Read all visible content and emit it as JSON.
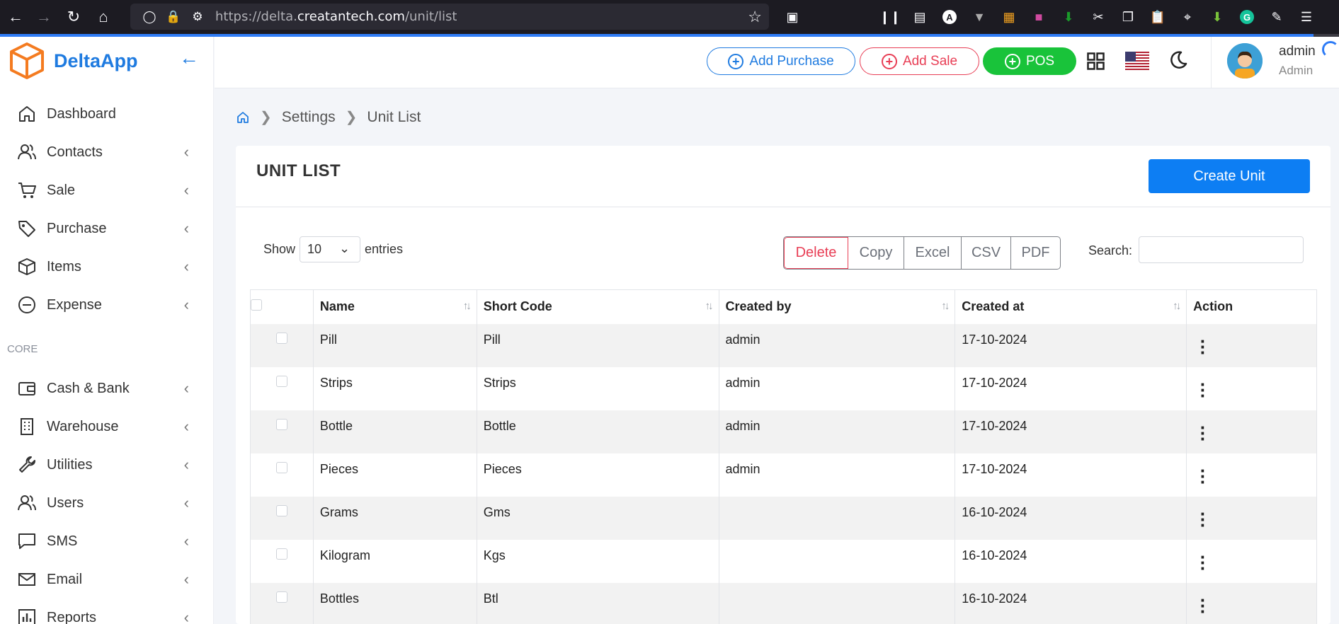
{
  "browser": {
    "url_prefix": "https://delta.",
    "url_domain": "creatantech.com",
    "url_path": "/unit/list"
  },
  "app": {
    "name": "DeltaApp"
  },
  "sidebar": {
    "items": [
      {
        "label": "Dashboard",
        "icon": "home-icon",
        "has_submenu": false
      },
      {
        "label": "Contacts",
        "icon": "contacts-icon",
        "has_submenu": true
      },
      {
        "label": "Sale",
        "icon": "cart-icon",
        "has_submenu": true
      },
      {
        "label": "Purchase",
        "icon": "tag-icon",
        "has_submenu": true
      },
      {
        "label": "Items",
        "icon": "box-icon",
        "has_submenu": true
      },
      {
        "label": "Expense",
        "icon": "minus-circle-icon",
        "has_submenu": true
      }
    ],
    "section_core": "CORE",
    "core_items": [
      {
        "label": "Cash & Bank",
        "icon": "wallet-icon",
        "has_submenu": true
      },
      {
        "label": "Warehouse",
        "icon": "building-icon",
        "has_submenu": true
      },
      {
        "label": "Utilities",
        "icon": "wrench-icon",
        "has_submenu": true
      },
      {
        "label": "Users",
        "icon": "users-icon",
        "has_submenu": true
      },
      {
        "label": "SMS",
        "icon": "message-icon",
        "has_submenu": true
      },
      {
        "label": "Email",
        "icon": "mail-icon",
        "has_submenu": true
      },
      {
        "label": "Reports",
        "icon": "chart-icon",
        "has_submenu": true
      }
    ]
  },
  "header": {
    "add_purchase": "Add Purchase",
    "add_sale": "Add Sale",
    "pos": "POS",
    "user_name": "admin",
    "user_role": "Admin"
  },
  "breadcrumb": {
    "items": [
      "Settings",
      "Unit List"
    ]
  },
  "page": {
    "title": "UNIT LIST",
    "create_button": "Create Unit",
    "show_label": "Show",
    "entries_label": "entries",
    "entries_value": "10",
    "search_label": "Search:",
    "export_buttons": [
      "Delete",
      "Copy",
      "Excel",
      "CSV",
      "PDF"
    ]
  },
  "table": {
    "columns": [
      "Name",
      "Short Code",
      "Created by",
      "Created at",
      "Action"
    ],
    "rows": [
      {
        "name": "Pill",
        "short_code": "Pill",
        "created_by": "admin",
        "created_at": "17-10-2024"
      },
      {
        "name": "Strips",
        "short_code": "Strips",
        "created_by": "admin",
        "created_at": "17-10-2024"
      },
      {
        "name": "Bottle",
        "short_code": "Bottle",
        "created_by": "admin",
        "created_at": "17-10-2024"
      },
      {
        "name": "Pieces",
        "short_code": "Pieces",
        "created_by": "admin",
        "created_at": "17-10-2024"
      },
      {
        "name": "Grams",
        "short_code": "Gms",
        "created_by": "",
        "created_at": "16-10-2024"
      },
      {
        "name": "Kilogram",
        "short_code": "Kgs",
        "created_by": "",
        "created_at": "16-10-2024"
      },
      {
        "name": "Bottles",
        "short_code": "Btl",
        "created_by": "",
        "created_at": "16-10-2024"
      }
    ]
  },
  "colors": {
    "primary": "#1f7be0",
    "danger": "#e83e55",
    "success": "#19c33a",
    "create_button": "#0d7ef3"
  }
}
